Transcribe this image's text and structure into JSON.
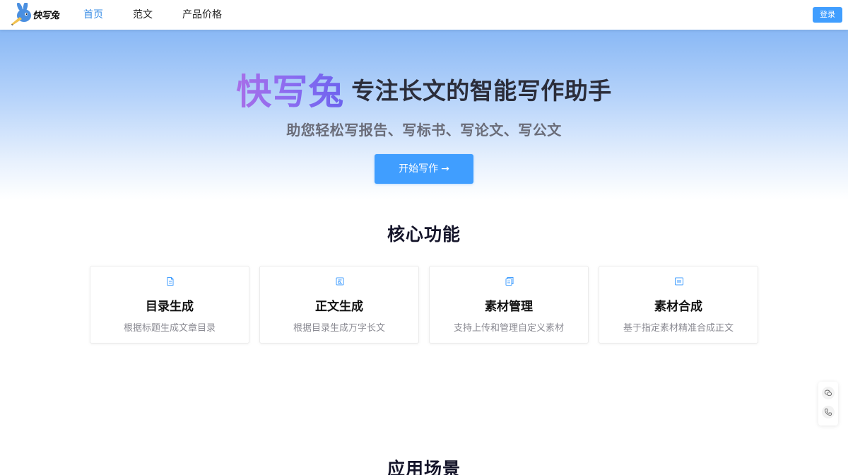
{
  "header": {
    "logo_text": "快写兔",
    "nav": [
      {
        "label": "首页",
        "active": true
      },
      {
        "label": "范文",
        "active": false
      },
      {
        "label": "产品价格",
        "active": false
      }
    ],
    "login_label": "登录"
  },
  "hero": {
    "brand": "快写兔",
    "slogan": "专注长文的智能写作助手",
    "subtitle": "助您轻松写报告、写标书、写论文、写公文",
    "cta_label": "开始写作",
    "cta_icon": "arrow-right-icon"
  },
  "features": {
    "title": "核心功能",
    "items": [
      {
        "icon": "document-icon",
        "title": "目录生成",
        "desc": "根据标题生成文章目录"
      },
      {
        "icon": "edit-document-icon",
        "title": "正文生成",
        "desc": "根据目录生成万字长文"
      },
      {
        "icon": "files-icon",
        "title": "素材管理",
        "desc": "支持上传和管理自定义素材"
      },
      {
        "icon": "merge-icon",
        "title": "素材合成",
        "desc": "基于指定素材精准合成正文"
      }
    ]
  },
  "scenarios": {
    "title": "应用场景"
  },
  "float_tools": [
    {
      "icon": "wechat-icon"
    },
    {
      "icon": "phone-icon"
    }
  ],
  "colors": {
    "primary": "#409eff",
    "nav_active": "#3a8ee6",
    "brand_gradient_start": "#a86ee8",
    "brand_gradient_end": "#6d63ee"
  }
}
